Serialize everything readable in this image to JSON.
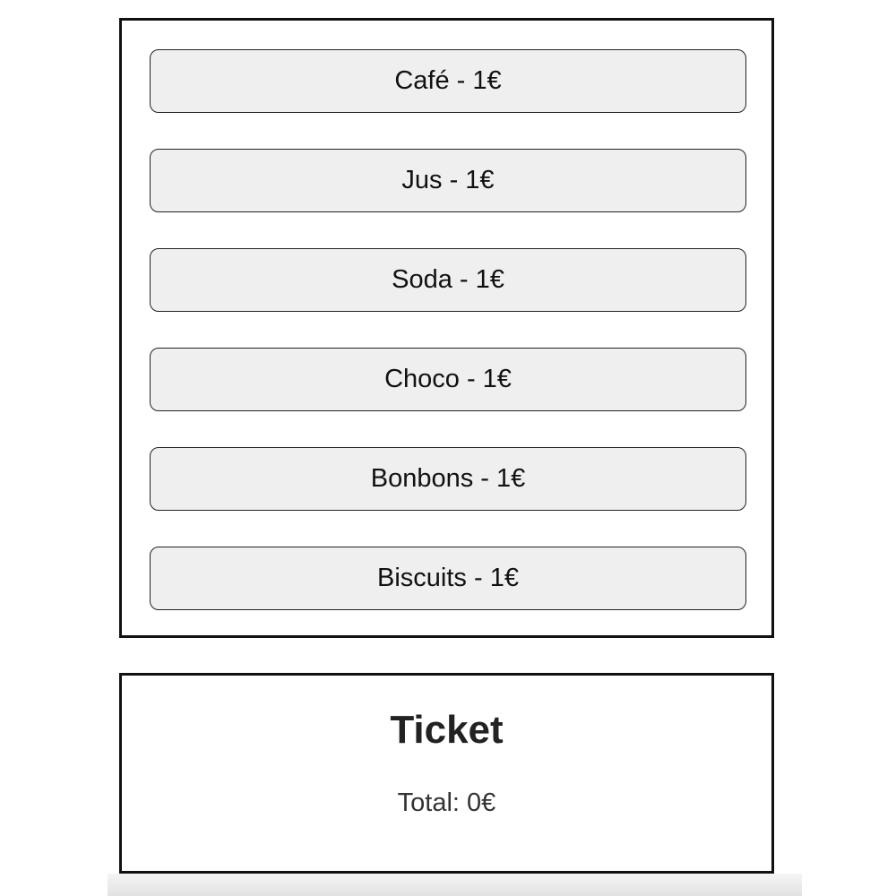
{
  "menu": {
    "items": [
      {
        "label": "Café - 1€"
      },
      {
        "label": "Jus - 1€"
      },
      {
        "label": "Soda - 1€"
      },
      {
        "label": "Choco - 1€"
      },
      {
        "label": "Bonbons - 1€"
      },
      {
        "label": "Biscuits - 1€"
      }
    ]
  },
  "ticket": {
    "title": "Ticket",
    "total": "Total: 0€"
  }
}
